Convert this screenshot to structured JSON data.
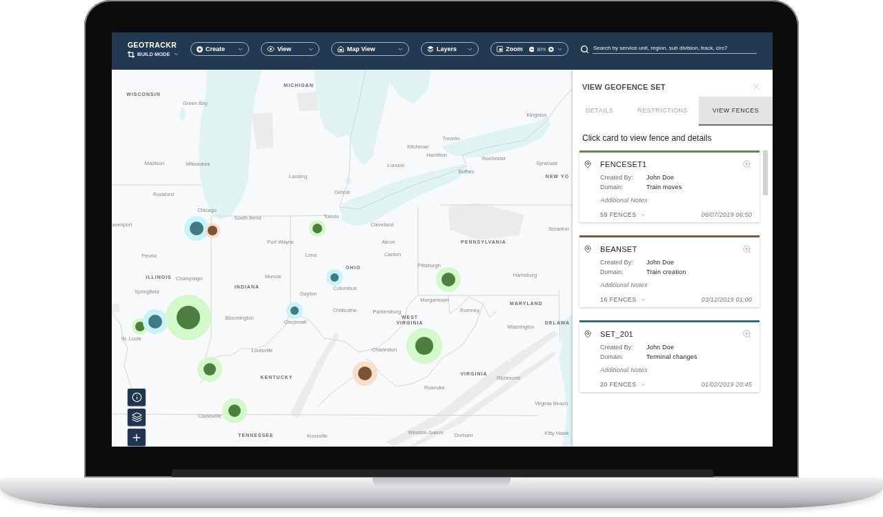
{
  "topbar": {
    "brand": "GEOTRACKR",
    "mode": "BUILD MODE",
    "menus": [
      {
        "kind": "dropdown",
        "label": "Create"
      },
      {
        "kind": "dropdown",
        "label": "View"
      },
      {
        "kind": "dropdown",
        "label": "Map View"
      },
      {
        "kind": "dropdown",
        "label": "Layers"
      },
      {
        "kind": "zoom",
        "label": "Zoom",
        "value": "80%"
      }
    ],
    "search": {
      "placeholder": "Search by service unit, region, sub division, track, circ7"
    }
  },
  "map": {
    "labels": [
      {
        "kind": "state",
        "text": "MICHIGAN"
      },
      {
        "kind": "state",
        "text": "WISCONSIN"
      },
      {
        "kind": "city",
        "text": "Green Bay"
      },
      {
        "kind": "city",
        "text": "Kingston"
      },
      {
        "kind": "city",
        "text": "Toronto"
      },
      {
        "kind": "city",
        "text": "Kitchener"
      },
      {
        "kind": "city",
        "text": "Hamilton"
      },
      {
        "kind": "city",
        "text": "Rochester"
      },
      {
        "kind": "city",
        "text": "Madison"
      },
      {
        "kind": "city",
        "text": "Milwaukee"
      },
      {
        "kind": "city",
        "text": "London"
      },
      {
        "kind": "city",
        "text": "Syracuse"
      },
      {
        "kind": "city",
        "text": "Buffalo"
      },
      {
        "kind": "city",
        "text": "Lansing"
      },
      {
        "kind": "state",
        "text": "NEW YO"
      },
      {
        "kind": "city",
        "text": "Rockford"
      },
      {
        "kind": "city",
        "text": "Detroit"
      },
      {
        "kind": "city",
        "text": "Chicago"
      },
      {
        "kind": "city",
        "text": "South Bend"
      },
      {
        "kind": "city",
        "text": "Toledo"
      },
      {
        "kind": "city",
        "text": "avenport"
      },
      {
        "kind": "city",
        "text": "Cleveland"
      },
      {
        "kind": "city",
        "text": "Scranton"
      },
      {
        "kind": "city",
        "text": "Fort Wayne"
      },
      {
        "kind": "city",
        "text": "Akron"
      },
      {
        "kind": "state",
        "text": "PENNSYLVANIA"
      },
      {
        "kind": "city",
        "text": "Peoria"
      },
      {
        "kind": "city",
        "text": "Lima"
      },
      {
        "kind": "city",
        "text": "Canton"
      },
      {
        "kind": "state",
        "text": "OHIO"
      },
      {
        "kind": "city",
        "text": "Pittsburgh"
      },
      {
        "kind": "state",
        "text": "ILLINOIS"
      },
      {
        "kind": "city",
        "text": "Champaign"
      },
      {
        "kind": "city",
        "text": "Muncie"
      },
      {
        "kind": "city",
        "text": "Harrisburg"
      },
      {
        "kind": "state",
        "text": "INDIANA"
      },
      {
        "kind": "city",
        "text": "Columbus"
      },
      {
        "kind": "city",
        "text": "Springfield"
      },
      {
        "kind": "city",
        "text": "Dayton"
      },
      {
        "kind": "city",
        "text": "Morgantown"
      },
      {
        "kind": "state",
        "text": "MARYLAND"
      },
      {
        "kind": "city",
        "text": "Chillicothe"
      },
      {
        "kind": "city",
        "text": "Parkersburg"
      },
      {
        "kind": "city",
        "text": "Romney"
      },
      {
        "kind": "city",
        "text": "Bloomington"
      },
      {
        "kind": "city",
        "text": "Cincinnati"
      },
      {
        "kind": "state",
        "text": "WEST VIRGINIA"
      },
      {
        "kind": "city",
        "text": "Washington"
      },
      {
        "kind": "state",
        "text": "DELAWA"
      },
      {
        "kind": "city",
        "text": "St. Louis"
      },
      {
        "kind": "city",
        "text": "Louisville"
      },
      {
        "kind": "city",
        "text": "Charleston"
      },
      {
        "kind": "state",
        "text": "KENTUCKY"
      },
      {
        "kind": "state",
        "text": "VIRGINIA"
      },
      {
        "kind": "city",
        "text": "Richmond"
      },
      {
        "kind": "city",
        "text": "Roanoke"
      },
      {
        "kind": "city",
        "text": "Virginia Beach"
      },
      {
        "kind": "city",
        "text": "Clarksville"
      },
      {
        "kind": "state",
        "text": "TENNESSEE"
      },
      {
        "kind": "city",
        "text": "Knoxville"
      },
      {
        "kind": "city",
        "text": "Winston-Salem"
      },
      {
        "kind": "city",
        "text": "Durham"
      },
      {
        "kind": "city",
        "text": "Kitty Hawk"
      }
    ],
    "markers": [
      {
        "color": "#3e7b83"
      },
      {
        "color": "#7a5535"
      },
      {
        "color": "#4e7f41"
      },
      {
        "color": "#3e7b83"
      },
      {
        "color": "#4e7f41"
      },
      {
        "color": "#4e7f41"
      },
      {
        "color": "#3e7b83"
      },
      {
        "color": "#4e7f41"
      },
      {
        "color": "#3e7b83"
      },
      {
        "color": "#4e7f41"
      },
      {
        "color": "#7a5535"
      },
      {
        "color": "#4e7f41"
      },
      {
        "color": "#4e7f41"
      }
    ]
  },
  "panel": {
    "title": "VIEW GEOFENCE SET",
    "tabs": [
      {
        "label": "DETAILS",
        "selected": false
      },
      {
        "label": "RESTRICTIONS",
        "selected": false
      },
      {
        "label": "VIEW FENCES",
        "selected": true
      }
    ],
    "hint": "Click card to view fence and details",
    "sets": [
      {
        "color": "#5b8c4b",
        "name": "FENCESET1",
        "fields": [
          {
            "label": "Created By:",
            "value": "John Doe"
          },
          {
            "label": "Domain:",
            "value": "Train moves"
          }
        ],
        "notes": "Additional Notes",
        "fences": "59 FENCES",
        "date": "06/07/2019 06:50"
      },
      {
        "color": "#7d5a3f",
        "name": "BEANSET",
        "fields": [
          {
            "label": "Created By:",
            "value": "John Doe"
          },
          {
            "label": "Domain:",
            "value": "Train creation"
          }
        ],
        "notes": "Additional Notes",
        "fences": "16 FENCES",
        "date": "03/12/2019 01:00"
      },
      {
        "color": "#2f6f74",
        "name": "SET_201",
        "fields": [
          {
            "label": "Created By:",
            "value": "John Doe"
          },
          {
            "label": "Domain:",
            "value": "Terminal changes"
          }
        ],
        "notes": "Additional Notes",
        "fences": "20 FENCES",
        "date": "01/02/2019 20:45"
      }
    ]
  }
}
